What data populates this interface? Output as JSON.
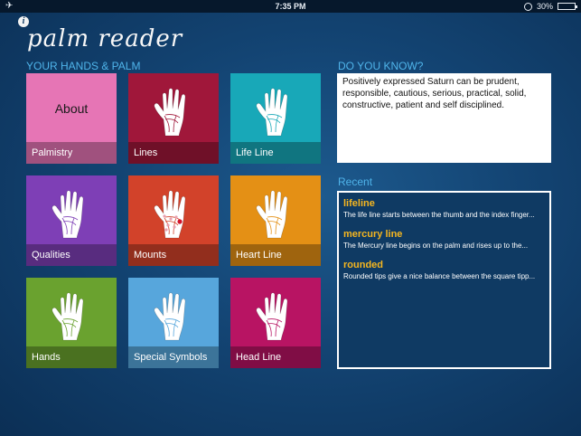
{
  "status_bar": {
    "time": "7:35 PM",
    "battery": "30%",
    "battery_level": 0.3
  },
  "app": {
    "title": "palm reader"
  },
  "tiles_section": {
    "label": "YOUR HANDS & PALM"
  },
  "tiles": [
    {
      "id": "about",
      "caption": "Palmistry",
      "center_text": "About",
      "color": "#e675b5",
      "hand": false
    },
    {
      "id": "lines",
      "caption": "Lines",
      "color": "#a0173a",
      "hand": true
    },
    {
      "id": "lifeline",
      "caption": "Life Line",
      "color": "#18a8b8",
      "hand": true
    },
    {
      "id": "qualities",
      "caption": "Qualities",
      "color": "#7e3fb6",
      "hand": true
    },
    {
      "id": "mounts",
      "caption": "Mounts",
      "color": "#d2422a",
      "hand": true,
      "dots": true
    },
    {
      "id": "heartline",
      "caption": "Heart Line",
      "color": "#e49015",
      "hand": true
    },
    {
      "id": "hands",
      "caption": "Hands",
      "color": "#6aa22f",
      "hand": true
    },
    {
      "id": "symbols",
      "caption": "Special Symbols",
      "color": "#57a6dc",
      "hand": true
    },
    {
      "id": "headline",
      "caption": "Head Line",
      "color": "#b81463",
      "hand": true
    }
  ],
  "did_you_know": {
    "label": "DO YOU KNOW?",
    "text": "Positively expressed Saturn can be prudent, responsible, cautious, serious, practical, solid, constructive, patient and self disciplined."
  },
  "recent": {
    "label": "Recent",
    "items": [
      {
        "title": "lifeline",
        "desc": "The life line starts between the thumb and the index finger..."
      },
      {
        "title": "mercury line",
        "desc": "The Mercury line begins on the palm and rises up to the..."
      },
      {
        "title": "rounded",
        "desc": "Rounded tips give a nice balance between the square tipp..."
      }
    ]
  }
}
